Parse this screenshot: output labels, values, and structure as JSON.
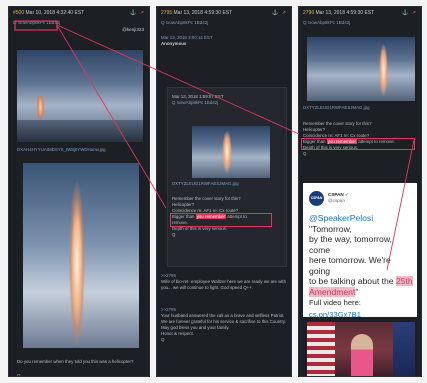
{
  "col1": {
    "header_id": "#500",
    "header_date": "Mar 10, 2018 4:32:40 EST",
    "subline": "Q !xowAbp8kPc 1Bd42j",
    "handle": "@kenji323",
    "caption": "DXAH4HYYUAIMDSYS_tW8j0YWDHanw.jpg",
    "question": "Do you remember when they told you this was a helicopter?"
  },
  "col2": {
    "header_id": "2795",
    "header_date": "Mar 13, 2018 4:59:30 EST",
    "subline": "Q !xowAbp8kPc 1Bd42j",
    "poster": "Anonymous",
    "poster_sub": "Mar 13, 2018 3:00:14 EST",
    "inner_date": "Mar 13, 2018 1:59:57 EST",
    "inner_sub": "Q !xowAbp8kPc 1Bd42j",
    "img_caption": "DXTYZLEUG1RWFAESJMAG.jpg",
    "remember": "Remember the cover story for this?",
    "helicopter": "Helicopter?",
    "coincidence": "Coincidence re: AF1 re: Cx route?",
    "bigger_prefix": "Bigger than",
    "bigger_red": "you remember",
    "bigger_suffix": "attempt to",
    "bigger_line2": "remove.",
    "depth": "Depth of this is very serious.",
    "q": "Q",
    "ref1": ">>2795",
    "body1": "Wife of bio-ret· employee Waltzer here we are ready we are with you... we will continue to fight. God speed Q++.",
    "ref2": ">>2795",
    "body2": "Your husband answered the call as a brave and selfless Patriot.",
    "body3": "We are forever grateful for his service & sacrifice to this Country.",
    "body4": "May god bless you and your family.",
    "body5": "Honor & respect.",
    "q2": "Q"
  },
  "col3": {
    "header_id": "2796",
    "header_date": "Mar 13, 2018 4:59:30 EST",
    "subline": "Q !xowAbp8kPc 1Bd42j",
    "img_caption": "DXTYZLEUG1RWFAESJMAG.jpg",
    "remember": "Remember the cover story for this?",
    "helicopter": "Helicopter?",
    "coincidence": "Coincidence re: AF1 re: Cx route?",
    "bigger_prefix": "Bigger than",
    "bigger_red": "you remember",
    "bigger_suffix": "attempt to remove.",
    "depth": "Depth of this is very serious.",
    "q": "Q",
    "tweet": {
      "logo": "CSPAN",
      "name": "CSPAN",
      "handle": "@cspan",
      "mention": "@SpeakerPelosi",
      "line1": "\"Tomorrow,",
      "line2": "by the way, tomorrow, come",
      "line3": "here tomorrow. We're going",
      "line4": "to be talking about the",
      "hl1": "25th",
      "hl2": "Amendment",
      "end_quote": "\"",
      "full_video_label": "Full video here:",
      "link": "cs.pn/33Gx7B1"
    }
  },
  "colors": {
    "panel": "#1c1f23",
    "highlight_red": "#e0365b",
    "tweet_blue": "#1a73c0"
  }
}
